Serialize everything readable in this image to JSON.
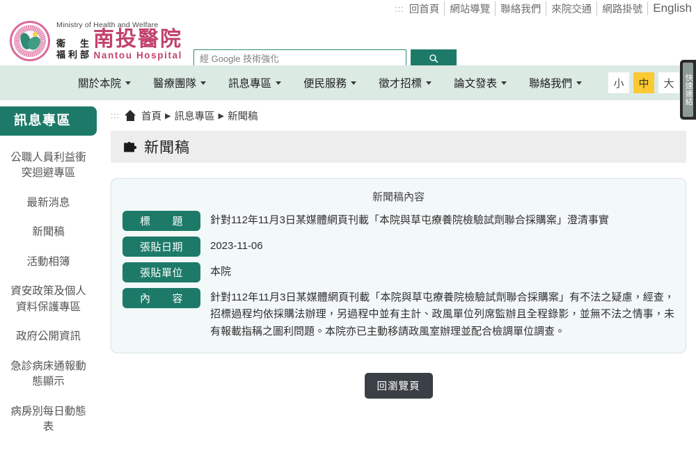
{
  "topbar": {
    "anchor": ":::",
    "links": [
      {
        "label": "回首頁"
      },
      {
        "label": "網站導覽"
      },
      {
        "label": "聯絡我們"
      },
      {
        "label": "來院交通"
      },
      {
        "label": "網路掛號"
      },
      {
        "label": "English"
      }
    ]
  },
  "brand": {
    "en_ministry": "Ministry of Health and Welfare",
    "cn_ministry_line1": "衛　生",
    "cn_ministry_line2": "福利部",
    "cn_hospital": "南投醫院",
    "en_hospital": "Nantou Hospital"
  },
  "search": {
    "placeholder": "經 Google 技術強化",
    "value": "",
    "button_icon": "search-icon"
  },
  "nav": {
    "items": [
      {
        "label": "關於本院"
      },
      {
        "label": "醫療團隊"
      },
      {
        "label": "訊息專區"
      },
      {
        "label": "便民服務"
      },
      {
        "label": "徵才招標"
      },
      {
        "label": "論文發表"
      },
      {
        "label": "聯絡我們"
      }
    ],
    "font_sizes": [
      {
        "label": "小",
        "active": false
      },
      {
        "label": "中",
        "active": true
      },
      {
        "label": "大",
        "active": false
      }
    ]
  },
  "quick_tab": {
    "label": "快速連結"
  },
  "sidebar": {
    "header": "訊息專區",
    "items": [
      {
        "label": "公職人員利益衝突迴避專區"
      },
      {
        "label": "最新消息"
      },
      {
        "label": "新聞稿"
      },
      {
        "label": "活動相簿"
      },
      {
        "label": "資安政策及個人資料保護專區"
      },
      {
        "label": "政府公開資訊"
      },
      {
        "label": "急診病床通報動態顯示"
      },
      {
        "label": "病房別每日動態表"
      }
    ]
  },
  "breadcrumb": {
    "anchor": ":::",
    "home_icon": "home-icon",
    "items": [
      {
        "label": "首頁"
      },
      {
        "label": "訊息專區"
      },
      {
        "label": "新聞稿"
      }
    ],
    "separator": "▶"
  },
  "page": {
    "title": "新聞稿",
    "title_icon": "puzzle-icon"
  },
  "panel": {
    "caption": "新聞稿內容",
    "rows": [
      {
        "label": "標　　題",
        "value": "針對112年11月3日某媒體網頁刊載「本院與草屯療養院檢驗試劑聯合採購案」澄清事實"
      },
      {
        "label": "張貼日期",
        "value": "2023-11-06"
      },
      {
        "label": "張貼單位",
        "value": "本院"
      },
      {
        "label": "內　　容",
        "value": "針對112年11月3日某媒體網頁刊載「本院與草屯療養院檢驗試劑聯合採購案」有不法之疑慮，經查，招標過程均依採購法辦理，另過程中並有主計、政風單位列席監辦且全程錄影，並無不法之情事，未有報載指稱之圖利問題。本院亦已主動移請政風室辦理並配合檢調單位調查。"
      }
    ]
  },
  "actions": {
    "back_label": "回瀏覽頁"
  },
  "colors": {
    "teal": "#1d7a68",
    "nav_bg": "#dceae4",
    "panel_bg": "#f3f8f9",
    "accent_yellow": "#fbc931",
    "brand_pink": "#c2426f",
    "back_btn": "#3b3f46"
  }
}
